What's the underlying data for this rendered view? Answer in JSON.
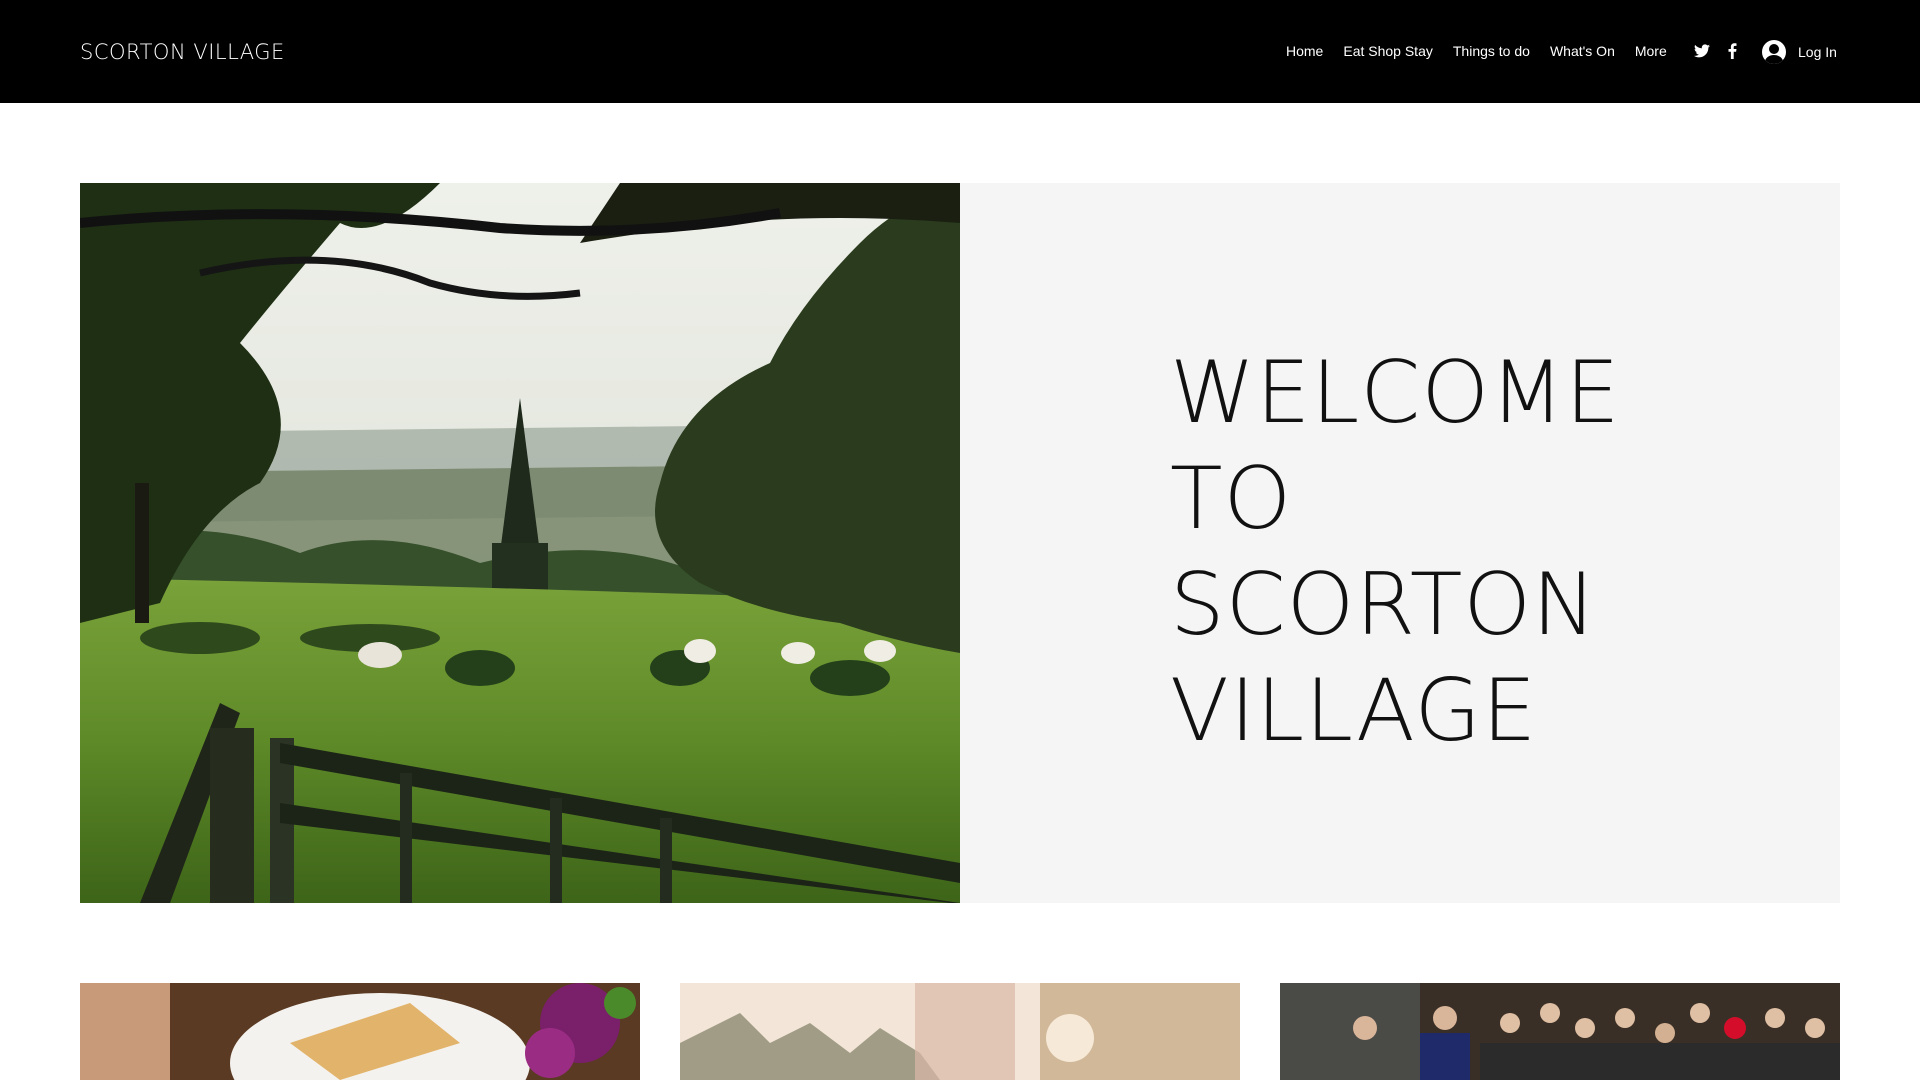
{
  "header": {
    "site_title": "SCORTON VILLAGE",
    "nav": [
      {
        "label": "Home"
      },
      {
        "label": "Eat Shop Stay"
      },
      {
        "label": "Things to do"
      },
      {
        "label": "What's On"
      },
      {
        "label": "More"
      }
    ],
    "social": [
      "twitter-icon",
      "facebook-icon"
    ],
    "login_label": "Log In"
  },
  "hero": {
    "heading": "WELCOME TO SCORTON VILLAGE",
    "image": "countryside-church-sheep-photo"
  },
  "cards": [
    {
      "image": "breakfast-table-flowers-photo"
    },
    {
      "image": "sunlit-outdoor-runner-photo"
    },
    {
      "image": "crowd-event-photo"
    }
  ],
  "colors": {
    "header_bg": "#000000",
    "panel_bg": "#f5f5f5",
    "text": "#111111"
  }
}
